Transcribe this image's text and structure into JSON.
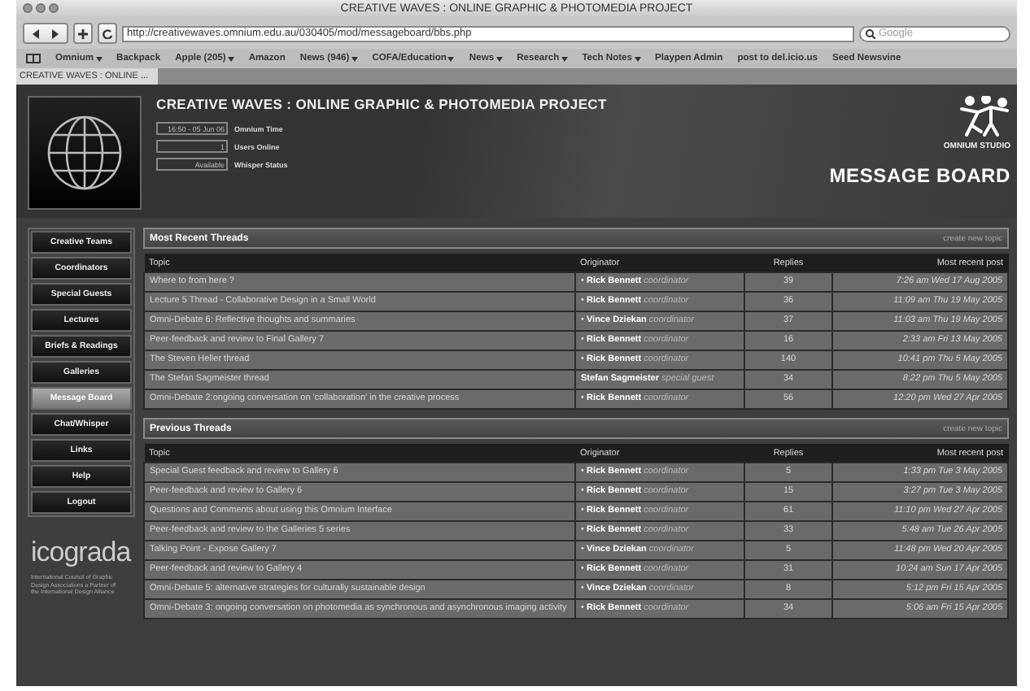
{
  "window": {
    "title": "CREATIVE WAVES : ONLINE GRAPHIC & PHOTOMEDIA PROJECT"
  },
  "toolbar": {
    "url": "http://creativewaves.omnium.edu.au/030405/mod/messageboard/bbs.php",
    "search_placeholder": "Google"
  },
  "bookmarks": [
    {
      "label": "Omnium",
      "menu": true
    },
    {
      "label": "Backpack",
      "menu": false
    },
    {
      "label": "Apple (205)",
      "menu": true
    },
    {
      "label": "Amazon",
      "menu": false
    },
    {
      "label": "News (946)",
      "menu": true
    },
    {
      "label": "COFA/Education",
      "menu": true
    },
    {
      "label": "News",
      "menu": true
    },
    {
      "label": "Research",
      "menu": true
    },
    {
      "label": "Tech Notes",
      "menu": true
    },
    {
      "label": "Playpen Admin",
      "menu": false
    },
    {
      "label": "post to del.icio.us",
      "menu": false
    },
    {
      "label": "Seed Newsvine",
      "menu": false
    }
  ],
  "tabs": [
    {
      "label": "CREATIVE WAVES : ONLINE ...",
      "selected": true
    }
  ],
  "header": {
    "title": "CREATIVE WAVES : ONLINE GRAPHIC & PHOTOMEDIA PROJECT",
    "stats": [
      {
        "value": "16:50 - 05 Jun 06",
        "label": "Omnium Time"
      },
      {
        "value": "1",
        "label": "Users Online"
      },
      {
        "value": "Available",
        "label": "Whisper Status"
      }
    ],
    "studio": "OMNIUM STUDIO",
    "section": "MESSAGE BOARD"
  },
  "sidebar": {
    "items": [
      {
        "label": "Creative Teams",
        "selected": false
      },
      {
        "label": "Coordinators",
        "selected": false
      },
      {
        "label": "Special Guests",
        "selected": false
      },
      {
        "label": "Lectures",
        "selected": false
      },
      {
        "label": "Briefs & Readings",
        "selected": false
      },
      {
        "label": "Galleries",
        "selected": false
      },
      {
        "label": "Message Board",
        "selected": true
      },
      {
        "label": "Chat/Whisper",
        "selected": false
      },
      {
        "label": "Links",
        "selected": false
      },
      {
        "label": "Help",
        "selected": false
      },
      {
        "label": "Logout",
        "selected": false
      }
    ],
    "logo": "icograda",
    "logo_note": "International Council of Graphic Design Associations a Partner of the International Design Alliance"
  },
  "sections": [
    {
      "title": "Most Recent Threads",
      "action": "create new topic",
      "columns": [
        "Topic",
        "Originator",
        "Replies",
        "Most recent post"
      ],
      "rows": [
        [
          "Where to from here ?",
          "• **Rick Bennett** *coordinator*",
          "39",
          "7:26 am Wed 17 Aug 2005"
        ],
        [
          "Lecture 5 Thread - Collaborative Design in a Small World",
          "• **Rick Bennett** *coordinator*",
          "36",
          "11:09 am Thu 19 May 2005"
        ],
        [
          "Omni-Debate 6: Reflective thoughts and summaries",
          "• **Vince Dziekan** *coordinator*",
          "37",
          "11:03 am Thu 19 May 2005"
        ],
        [
          "Peer-feedback and review to Final Gallery 7",
          "• **Rick Bennett** *coordinator*",
          "16",
          "2:33 am Fri 13 May 2005"
        ],
        [
          "The Steven Heller thread",
          "• **Rick Bennett** *coordinator*",
          "140",
          "10:41 pm Thu 5 May 2005"
        ],
        [
          "The Stefan Sagmeister thread",
          "**Stefan Sagmeister** *special guest*",
          "34",
          "8:22 pm Thu 5 May 2005"
        ],
        [
          "Omni-Debate 2:ongoing conversation on 'collaboration' in the creative process",
          "• **Rick Bennett** *coordinator*",
          "56",
          "12:20 pm Wed 27 Apr 2005"
        ]
      ]
    },
    {
      "title": "Previous Threads",
      "action": "create new topic",
      "columns": [
        "Topic",
        "Originator",
        "Replies",
        "Most recent post"
      ],
      "rows": [
        [
          "Special Guest feedback and review to Gallery 6",
          "• **Rick Bennett** *coordinator*",
          "5",
          "1:33 pm Tue 3 May 2005"
        ],
        [
          "Peer-feedback and review to Gallery 6",
          "• **Rick Bennett** *coordinator*",
          "15",
          "3:27 pm Tue 3 May 2005"
        ],
        [
          "Questions and Comments about using this Omnium Interface",
          "• **Rick Bennett** *coordinator*",
          "61",
          "11:10 pm Wed 27 Apr 2005"
        ],
        [
          "Peer-feedback and review to the Galleries 5 series",
          "• **Rick Bennett** *coordinator*",
          "33",
          "5:48 am Tue 26 Apr 2005"
        ],
        [
          "Talking Point - Expose Gallery 7",
          "• **Vince Dziekan** *coordinator*",
          "5",
          "11:48 pm Wed 20 Apr 2005"
        ],
        [
          "Peer-feedback and review to Gallery 4",
          "• **Rick Bennett** *coordinator*",
          "31",
          "10:24 am Sun 17 Apr 2005"
        ],
        [
          "Omni-Debate 5: alternative strategies for culturally sustainable design",
          "• **Vince Dziekan** *coordinator*",
          "8",
          "5:12 pm Fri 15 Apr 2005"
        ],
        [
          "Omni-Debate 3: ongoing conversation on photomedia as synchronous and asynchronous imaging activity",
          "• **Rick Bennett** *coordinator*",
          "34",
          "5:06 am Fri 15 Apr 2005"
        ]
      ]
    }
  ]
}
